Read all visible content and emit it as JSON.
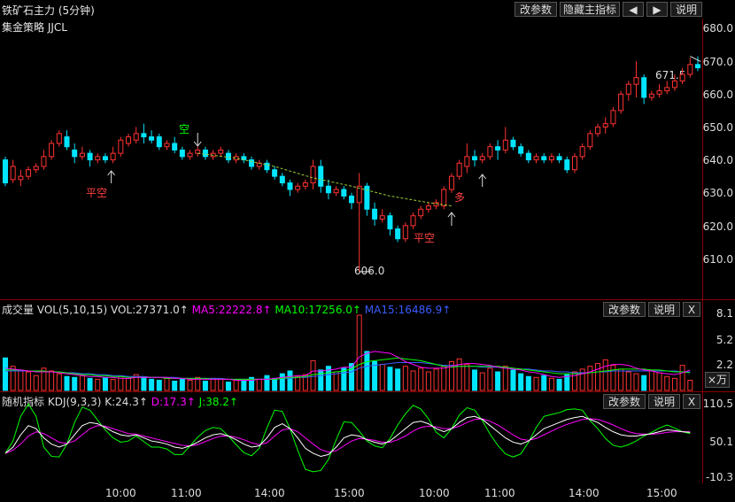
{
  "header": {
    "title": "铁矿石主力 (5分钟)",
    "strategy": "集金策略 JJCL",
    "buttons": [
      "改参数",
      "隐藏主指标",
      "◀",
      "▶",
      "说明"
    ]
  },
  "main_axis": [
    "680.0",
    "670.0",
    "660.0",
    "650.0",
    "640.0",
    "630.0",
    "620.0",
    "610.0"
  ],
  "annotations": {
    "low_label": "606.0",
    "high_label": "671.5",
    "signals": [
      "平空",
      "空",
      "平空",
      "多"
    ]
  },
  "vol_panel": {
    "title": "成交量",
    "params": "VOL(5,10,15)",
    "vol": "VOL:27371.0↑",
    "ma5": "MA5:22222.8↑",
    "ma10": "MA10:17256.0↑",
    "ma15": "MA15:16486.9↑",
    "buttons": [
      "改参数",
      "说明",
      "X"
    ],
    "axis": [
      "8.1",
      "5.2",
      "2.2"
    ],
    "unit": "×万"
  },
  "kdj_panel": {
    "title": "随机指标",
    "params": "KDJ(9,3,3)",
    "k": "K:24.3↑",
    "d": "D:17.3↑",
    "j": "J:38.2↑",
    "buttons": [
      "改参数",
      "说明",
      "X"
    ],
    "axis": [
      "110.5",
      "50.1",
      "-10.3"
    ]
  },
  "time_axis": [
    "10:00",
    "11:00",
    "14:00",
    "15:00",
    "10:00",
    "11:00",
    "14:00",
    "15:00"
  ],
  "colors": {
    "up": "#ff3232",
    "down": "#00e5ff",
    "ma5": "#ff00ff",
    "ma10": "#00ff00",
    "ma15": "#3b5bff",
    "k": "#ffffff",
    "d": "#ff00ff",
    "j": "#00ff00"
  },
  "chart_data": {
    "type": "candlestick",
    "title": "铁矿石主力 (5分钟)",
    "ylim": [
      602,
      682
    ],
    "candles": [
      {
        "o": 640,
        "h": 641,
        "c": 633,
        "l": 632
      },
      {
        "o": 634,
        "h": 640,
        "c": 638,
        "l": 633
      },
      {
        "o": 634,
        "h": 637,
        "c": 635,
        "l": 632
      },
      {
        "o": 635,
        "h": 638,
        "c": 637,
        "l": 634
      },
      {
        "o": 637,
        "h": 639,
        "c": 638,
        "l": 636
      },
      {
        "o": 638,
        "h": 643,
        "c": 641,
        "l": 637
      },
      {
        "o": 641,
        "h": 646,
        "c": 645,
        "l": 640
      },
      {
        "o": 645,
        "h": 649,
        "c": 648,
        "l": 644
      },
      {
        "o": 647,
        "h": 649,
        "c": 644,
        "l": 643
      },
      {
        "o": 643,
        "h": 645,
        "c": 641,
        "l": 639
      },
      {
        "o": 641,
        "h": 644,
        "c": 642,
        "l": 640
      },
      {
        "o": 642,
        "h": 643,
        "c": 640,
        "l": 638
      },
      {
        "o": 640,
        "h": 642,
        "c": 641,
        "l": 639
      },
      {
        "o": 641,
        "h": 642,
        "c": 640,
        "l": 639
      },
      {
        "o": 640,
        "h": 644,
        "c": 642,
        "l": 639
      },
      {
        "o": 642,
        "h": 647,
        "c": 646,
        "l": 641
      },
      {
        "o": 645,
        "h": 648,
        "c": 647,
        "l": 644
      },
      {
        "o": 646,
        "h": 650,
        "c": 648,
        "l": 645
      },
      {
        "o": 648,
        "h": 651,
        "c": 647,
        "l": 645
      },
      {
        "o": 647,
        "h": 649,
        "c": 646,
        "l": 645
      },
      {
        "o": 647,
        "h": 648,
        "c": 644,
        "l": 643
      },
      {
        "o": 644,
        "h": 646,
        "c": 645,
        "l": 643
      },
      {
        "o": 645,
        "h": 647,
        "c": 643,
        "l": 642
      },
      {
        "o": 643,
        "h": 644,
        "c": 641,
        "l": 640
      },
      {
        "o": 641,
        "h": 643,
        "c": 642,
        "l": 640
      },
      {
        "o": 642,
        "h": 644,
        "c": 643,
        "l": 641
      },
      {
        "o": 643,
        "h": 644,
        "c": 641,
        "l": 640
      },
      {
        "o": 641,
        "h": 643,
        "c": 642,
        "l": 640
      },
      {
        "o": 642,
        "h": 644,
        "c": 643,
        "l": 641
      },
      {
        "o": 642,
        "h": 643,
        "c": 640,
        "l": 639
      },
      {
        "o": 640,
        "h": 642,
        "c": 641,
        "l": 639
      },
      {
        "o": 641,
        "h": 642,
        "c": 640,
        "l": 639
      },
      {
        "o": 640,
        "h": 641,
        "c": 638,
        "l": 637
      },
      {
        "o": 638,
        "h": 640,
        "c": 639,
        "l": 637
      },
      {
        "o": 639,
        "h": 640,
        "c": 637,
        "l": 636
      },
      {
        "o": 637,
        "h": 638,
        "c": 635,
        "l": 634
      },
      {
        "o": 635,
        "h": 636,
        "c": 633,
        "l": 632
      },
      {
        "o": 633,
        "h": 634,
        "c": 631,
        "l": 629
      },
      {
        "o": 631,
        "h": 633,
        "c": 632,
        "l": 630
      },
      {
        "o": 632,
        "h": 634,
        "c": 633,
        "l": 631
      },
      {
        "o": 633,
        "h": 640,
        "c": 638,
        "l": 631
      },
      {
        "o": 638,
        "h": 640,
        "c": 632,
        "l": 630
      },
      {
        "o": 632,
        "h": 634,
        "c": 630,
        "l": 628
      },
      {
        "o": 630,
        "h": 632,
        "c": 631,
        "l": 629
      },
      {
        "o": 631,
        "h": 632,
        "c": 629,
        "l": 628
      },
      {
        "o": 629,
        "h": 630,
        "c": 627,
        "l": 625
      },
      {
        "o": 627,
        "h": 636,
        "c": 632,
        "l": 606
      },
      {
        "o": 632,
        "h": 633,
        "c": 625,
        "l": 623
      },
      {
        "o": 625,
        "h": 627,
        "c": 622,
        "l": 620
      },
      {
        "o": 622,
        "h": 625,
        "c": 623,
        "l": 621
      },
      {
        "o": 623,
        "h": 624,
        "c": 619,
        "l": 617
      },
      {
        "o": 619,
        "h": 620,
        "c": 616,
        "l": 615
      },
      {
        "o": 616,
        "h": 621,
        "c": 620,
        "l": 615
      },
      {
        "o": 620,
        "h": 624,
        "c": 623,
        "l": 619
      },
      {
        "o": 623,
        "h": 626,
        "c": 625,
        "l": 622
      },
      {
        "o": 625,
        "h": 627,
        "c": 626,
        "l": 624
      },
      {
        "o": 626,
        "h": 628,
        "c": 627,
        "l": 625
      },
      {
        "o": 626,
        "h": 632,
        "c": 631,
        "l": 625
      },
      {
        "o": 631,
        "h": 636,
        "c": 635,
        "l": 630
      },
      {
        "o": 635,
        "h": 640,
        "c": 639,
        "l": 634
      },
      {
        "o": 638,
        "h": 645,
        "c": 641,
        "l": 636
      },
      {
        "o": 641,
        "h": 643,
        "c": 640,
        "l": 638
      },
      {
        "o": 640,
        "h": 642,
        "c": 641,
        "l": 639
      },
      {
        "o": 641,
        "h": 645,
        "c": 644,
        "l": 640
      },
      {
        "o": 644,
        "h": 646,
        "c": 643,
        "l": 640
      },
      {
        "o": 643,
        "h": 650,
        "c": 646,
        "l": 642
      },
      {
        "o": 646,
        "h": 647,
        "c": 644,
        "l": 643
      },
      {
        "o": 644,
        "h": 645,
        "c": 642,
        "l": 641
      },
      {
        "o": 642,
        "h": 643,
        "c": 640,
        "l": 639
      },
      {
        "o": 640,
        "h": 642,
        "c": 641,
        "l": 639
      },
      {
        "o": 641,
        "h": 642,
        "c": 640,
        "l": 639
      },
      {
        "o": 640,
        "h": 642,
        "c": 641,
        "l": 639
      },
      {
        "o": 641,
        "h": 642,
        "c": 640,
        "l": 639
      },
      {
        "o": 640,
        "h": 641,
        "c": 637,
        "l": 636
      },
      {
        "o": 637,
        "h": 642,
        "c": 641,
        "l": 636
      },
      {
        "o": 641,
        "h": 645,
        "c": 644,
        "l": 640
      },
      {
        "o": 644,
        "h": 649,
        "c": 648,
        "l": 643
      },
      {
        "o": 648,
        "h": 651,
        "c": 650,
        "l": 647
      },
      {
        "o": 650,
        "h": 653,
        "c": 651,
        "l": 648
      },
      {
        "o": 651,
        "h": 656,
        "c": 655,
        "l": 650
      },
      {
        "o": 655,
        "h": 661,
        "c": 660,
        "l": 654
      },
      {
        "o": 660,
        "h": 664,
        "c": 663,
        "l": 658
      },
      {
        "o": 663,
        "h": 670,
        "c": 665,
        "l": 659
      },
      {
        "o": 665,
        "h": 666,
        "c": 659,
        "l": 657
      },
      {
        "o": 659,
        "h": 661,
        "c": 660,
        "l": 658
      },
      {
        "o": 660,
        "h": 663,
        "c": 661,
        "l": 659
      },
      {
        "o": 661,
        "h": 664,
        "c": 662,
        "l": 660
      },
      {
        "o": 662,
        "h": 666,
        "c": 664,
        "l": 661
      },
      {
        "o": 664,
        "h": 668,
        "c": 666,
        "l": 663
      },
      {
        "o": 666,
        "h": 671,
        "c": 669,
        "l": 665
      },
      {
        "o": 669,
        "h": 671.5,
        "c": 668,
        "l": 667
      }
    ],
    "ma_line": [
      {
        "i": 25,
        "v": 642
      },
      {
        "i": 30,
        "v": 640.5
      },
      {
        "i": 35,
        "v": 638
      },
      {
        "i": 40,
        "v": 634.5
      },
      {
        "i": 45,
        "v": 632
      },
      {
        "i": 50,
        "v": 629
      },
      {
        "i": 55,
        "v": 627
      },
      {
        "i": 58,
        "v": 626
      }
    ],
    "volume": [
      3.5,
      2.6,
      2.2,
      2.0,
      1.6,
      2.4,
      2.1,
      1.8,
      1.5,
      1.4,
      1.6,
      1.3,
      1.2,
      1.4,
      1.2,
      1.5,
      1.3,
      1.7,
      1.4,
      1.2,
      1.1,
      1.3,
      1.0,
      1.2,
      1.1,
      1.4,
      1.0,
      1.3,
      1.2,
      0.9,
      1.1,
      1.0,
      1.4,
      1.2,
      1.6,
      1.3,
      1.8,
      2.1,
      1.5,
      1.7,
      3.2,
      2.2,
      2.6,
      2.0,
      2.4,
      2.9,
      8.1,
      4.2,
      3.1,
      2.8,
      2.5,
      2.3,
      2.6,
      2.1,
      2.4,
      2.0,
      2.3,
      2.6,
      3.1,
      3.4,
      2.8,
      2.2,
      1.9,
      2.4,
      2.0,
      2.6,
      2.2,
      1.8,
      1.5,
      1.4,
      1.6,
      1.3,
      1.2,
      1.7,
      2.0,
      2.3,
      2.6,
      2.9,
      3.3,
      2.7,
      2.3,
      2.0,
      1.8,
      1.6,
      2.2,
      1.9,
      1.5,
      1.3,
      2.7,
      1.1
    ],
    "vol_ma5": [
      2.4,
      2.3,
      2.2,
      2.1,
      2.0,
      2.0,
      2.0,
      1.9,
      1.8,
      1.7,
      1.6,
      1.5,
      1.5,
      1.4,
      1.4,
      1.3,
      1.3,
      1.4,
      1.4,
      1.4,
      1.4,
      1.4,
      1.3,
      1.3,
      1.2,
      1.2,
      1.2,
      1.2,
      1.2,
      1.2,
      1.1,
      1.1,
      1.1,
      1.2,
      1.2,
      1.3,
      1.4,
      1.5,
      1.6,
      1.6,
      2.1,
      2.1,
      2.2,
      2.3,
      2.5,
      2.5,
      3.6,
      4.0,
      4.2,
      4.1,
      4.0,
      3.6,
      3.1,
      2.8,
      2.5,
      2.4,
      2.4,
      2.4,
      2.6,
      2.8,
      2.9,
      2.9,
      2.8,
      2.7,
      2.5,
      2.4,
      2.3,
      2.2,
      2.0,
      1.9,
      1.7,
      1.5,
      1.4,
      1.5,
      1.6,
      1.8,
      2.0,
      2.3,
      2.6,
      2.8,
      2.8,
      2.7,
      2.4,
      2.2,
      2.1,
      1.9,
      1.8,
      1.7,
      1.9,
      2.2
    ],
    "vol_ma10": [
      2.2,
      2.2,
      2.2,
      2.1,
      2.1,
      2.1,
      2.0,
      2.0,
      1.9,
      1.8,
      1.7,
      1.7,
      1.6,
      1.6,
      1.5,
      1.5,
      1.4,
      1.4,
      1.4,
      1.4,
      1.4,
      1.3,
      1.3,
      1.3,
      1.3,
      1.3,
      1.3,
      1.2,
      1.2,
      1.2,
      1.2,
      1.2,
      1.2,
      1.2,
      1.2,
      1.2,
      1.3,
      1.4,
      1.4,
      1.5,
      1.7,
      1.8,
      1.9,
      2.0,
      2.1,
      2.3,
      2.8,
      3.1,
      3.2,
      3.3,
      3.4,
      3.5,
      3.4,
      3.3,
      3.2,
      3.0,
      2.8,
      2.6,
      2.5,
      2.6,
      2.6,
      2.6,
      2.6,
      2.6,
      2.6,
      2.5,
      2.4,
      2.3,
      2.2,
      2.1,
      2.0,
      1.9,
      1.8,
      1.8,
      1.8,
      1.8,
      1.9,
      2.0,
      2.1,
      2.2,
      2.3,
      2.3,
      2.3,
      2.3,
      2.2,
      2.2,
      2.1,
      2.0,
      2.0,
      1.9
    ],
    "vol_ma15": [
      2.1,
      2.1,
      2.1,
      2.1,
      2.1,
      2.0,
      2.0,
      2.0,
      1.9,
      1.9,
      1.8,
      1.8,
      1.7,
      1.7,
      1.6,
      1.6,
      1.5,
      1.5,
      1.5,
      1.4,
      1.4,
      1.4,
      1.4,
      1.3,
      1.3,
      1.3,
      1.3,
      1.3,
      1.3,
      1.2,
      1.2,
      1.2,
      1.2,
      1.2,
      1.2,
      1.2,
      1.3,
      1.3,
      1.4,
      1.4,
      1.5,
      1.6,
      1.7,
      1.8,
      1.9,
      2.0,
      2.4,
      2.6,
      2.7,
      2.8,
      2.9,
      3.0,
      3.0,
      3.0,
      3.0,
      2.9,
      2.8,
      2.7,
      2.7,
      2.6,
      2.6,
      2.6,
      2.5,
      2.5,
      2.5,
      2.4,
      2.4,
      2.3,
      2.3,
      2.2,
      2.1,
      2.1,
      2.0,
      2.0,
      1.9,
      1.9,
      1.9,
      2.0,
      2.0,
      2.1,
      2.1,
      2.1,
      2.1,
      2.1,
      2.1,
      2.1,
      2.1,
      2.1,
      2.0,
      2.0
    ],
    "kdj_k": [
      30,
      40,
      60,
      75,
      70,
      55,
      45,
      40,
      45,
      60,
      75,
      80,
      78,
      72,
      65,
      60,
      58,
      60,
      55,
      50,
      48,
      45,
      40,
      38,
      42,
      48,
      55,
      60,
      62,
      58,
      52,
      45,
      40,
      42,
      55,
      72,
      78,
      70,
      55,
      38,
      30,
      25,
      28,
      40,
      55,
      60,
      58,
      52,
      48,
      45,
      50,
      60,
      70,
      80,
      82,
      78,
      70,
      65,
      70,
      80,
      88,
      90,
      85,
      75,
      65,
      55,
      48,
      45,
      50,
      60,
      70,
      75,
      80,
      85,
      88,
      90,
      85,
      80,
      72,
      65,
      60,
      58,
      58,
      60,
      62,
      65,
      68,
      67,
      65,
      64
    ],
    "kdj_d": [
      30,
      35,
      45,
      58,
      65,
      62,
      55,
      48,
      46,
      50,
      60,
      70,
      75,
      74,
      70,
      66,
      62,
      61,
      58,
      55,
      52,
      49,
      46,
      43,
      42,
      44,
      49,
      54,
      58,
      58,
      56,
      52,
      47,
      44,
      47,
      58,
      68,
      70,
      65,
      55,
      45,
      36,
      32,
      34,
      42,
      50,
      54,
      53,
      51,
      48,
      48,
      52,
      58,
      66,
      72,
      74,
      73,
      70,
      70,
      74,
      80,
      85,
      86,
      82,
      76,
      68,
      60,
      53,
      51,
      54,
      60,
      66,
      72,
      77,
      81,
      85,
      86,
      85,
      81,
      76,
      70,
      65,
      62,
      61,
      61,
      62,
      64,
      65,
      65,
      65
    ],
    "kdj_j": [
      30,
      50,
      90,
      110,
      90,
      40,
      25,
      24,
      45,
      80,
      105,
      100,
      84,
      68,
      55,
      48,
      50,
      58,
      49,
      40,
      40,
      37,
      28,
      28,
      42,
      56,
      67,
      72,
      70,
      58,
      44,
      31,
      26,
      38,
      71,
      100,
      98,
      70,
      35,
      4,
      0,
      2,
      20,
      52,
      81,
      80,
      66,
      50,
      42,
      39,
      54,
      76,
      94,
      108,
      102,
      86,
      64,
      55,
      70,
      92,
      104,
      100,
      83,
      61,
      43,
      29,
      24,
      29,
      48,
      72,
      90,
      93,
      96,
      101,
      102,
      100,
      83,
      70,
      54,
      43,
      40,
      44,
      50,
      58,
      64,
      71,
      76,
      71,
      65,
      62
    ]
  }
}
